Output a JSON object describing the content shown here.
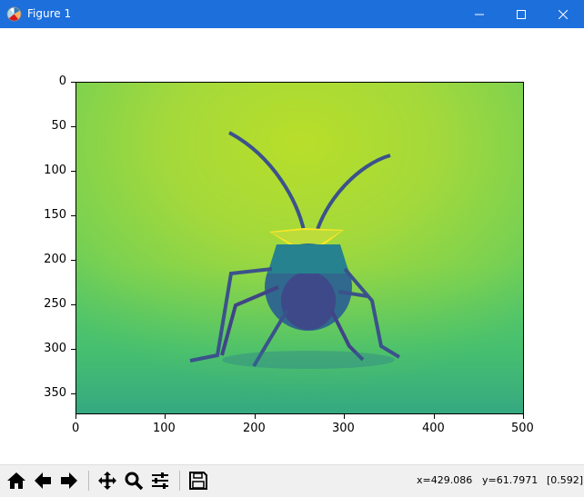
{
  "window": {
    "title": "Figure 1"
  },
  "axes": {
    "y_ticks": [
      "0",
      "50",
      "100",
      "150",
      "200",
      "250",
      "300",
      "350"
    ],
    "x_ticks": [
      "0",
      "100",
      "200",
      "300",
      "400",
      "500"
    ]
  },
  "status": {
    "x": "x=429.086",
    "y": "y=61.7971",
    "value": "[0.592]"
  },
  "colors": {
    "titlebar": "#1d6fdc",
    "toolbar": "#f0f0f0"
  },
  "icons": [
    "matplotlib-icon",
    "home-icon",
    "back-icon",
    "forward-icon",
    "pan-icon",
    "zoom-icon",
    "configure-icon",
    "save-icon"
  ]
}
